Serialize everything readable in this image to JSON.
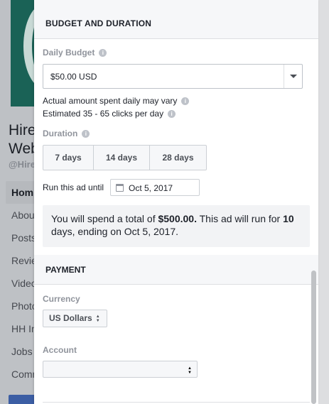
{
  "background": {
    "page_name_lines": [
      "Hire",
      "Web"
    ],
    "page_handle": "@Hire",
    "nav_items": [
      "Hom",
      "Abou",
      "Posts",
      "Revie",
      "Video",
      "Photo",
      "HH In",
      "Jobs",
      "Comm"
    ]
  },
  "budget_section": {
    "title": "BUDGET AND DURATION",
    "daily_budget_label": "Daily Budget",
    "daily_budget_value": "$50.00 USD",
    "note_vary": "Actual amount spent daily may vary",
    "note_clicks": "Estimated 35 - 65 clicks per day",
    "duration_label": "Duration",
    "duration_options": [
      "7 days",
      "14 days",
      "28 days"
    ],
    "run_until_label": "Run this ad until",
    "end_date": "Oct 5, 2017",
    "summary": {
      "prefix": "You will spend a total of ",
      "total": "$500.00.",
      "middle": " This ad will run for ",
      "days": "10",
      "suffix": " days, ending on Oct 5, 2017."
    }
  },
  "payment_section": {
    "title": "PAYMENT",
    "currency_label": "Currency",
    "currency_value": "US Dollars",
    "account_label": "Account",
    "account_value": ""
  },
  "icons": {
    "info": "i",
    "updown": "▲▼"
  },
  "colors": {
    "modal_bg": "#ffffff",
    "header_bg": "#f6f7f9",
    "summary_bg": "#f2f3f5",
    "label_gray": "#90949c",
    "text_dark": "#1d2129"
  }
}
